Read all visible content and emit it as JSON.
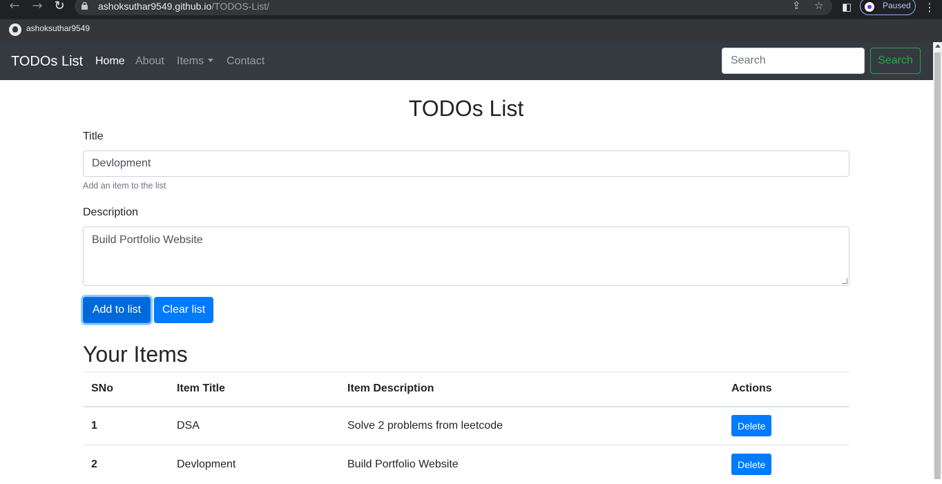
{
  "browser": {
    "url_host": "ashoksuthar9549.github.io",
    "url_path": "/TODOS-List/",
    "profile_status": "Paused",
    "bookmark": "ashoksuthar9549"
  },
  "navbar": {
    "brand": "TODOs List",
    "links": [
      "Home",
      "About",
      "Items",
      "Contact"
    ],
    "search_placeholder": "Search",
    "search_button": "Search"
  },
  "main": {
    "title": "TODOs List",
    "title_label": "Title",
    "title_value": "Devlopment",
    "title_help": "Add an item to the list",
    "description_label": "Description",
    "description_value": "Build Portfolio Website",
    "add_button": "Add to list",
    "clear_button": "Clear list"
  },
  "items": {
    "heading": "Your Items",
    "columns": [
      "SNo",
      "Item Title",
      "Item Description",
      "Actions"
    ],
    "rows": [
      {
        "sno": "1",
        "title": "DSA",
        "description": "Solve 2 problems from leetcode",
        "action": "Delete"
      },
      {
        "sno": "2",
        "title": "Devlopment",
        "description": "Build Portfolio Website",
        "action": "Delete"
      }
    ]
  }
}
